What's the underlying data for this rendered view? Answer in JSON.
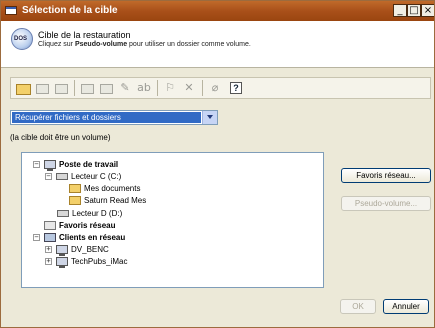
{
  "window": {
    "title": "Sélection de la cible"
  },
  "header": {
    "title": "Cible de la restauration",
    "subtitle_pre": "Cliquez sur ",
    "subtitle_bold": "Pseudo-volume",
    "subtitle_post": " pour utiliser un dossier comme volume."
  },
  "toolbar": {
    "icons": [
      "new-folder-icon",
      "folder-up-icon",
      "folder-icon",
      "properties-icon",
      "new-item-icon",
      "rename-icon",
      "label-icon",
      "flag-icon",
      "delete-icon",
      "edit-icon",
      "help-icon"
    ]
  },
  "dropdown": {
    "selected": "Récupérer fichiers et dossiers"
  },
  "note": "(la cible doit être un volume)",
  "tree": {
    "items": [
      {
        "label": "Poste de travail",
        "bold": true,
        "expander": "−"
      },
      {
        "label": "Lecteur C (C:)",
        "bold": false,
        "expander": "−"
      },
      {
        "label": "Mes documents",
        "bold": false
      },
      {
        "label": "Saturn Read Mes",
        "bold": false
      },
      {
        "label": "Lecteur D (D:)",
        "bold": false
      },
      {
        "label": "Favoris réseau",
        "bold": true
      },
      {
        "label": "Clients en réseau",
        "bold": true,
        "expander": "−"
      },
      {
        "label": "DV_BENC",
        "bold": false,
        "expander": "+"
      },
      {
        "label": "TechPubs_iMac",
        "bold": false,
        "expander": "+"
      }
    ]
  },
  "buttons": {
    "favoris": "Favoris réseau...",
    "pseudo": "Pseudo-volume...",
    "ok": "OK",
    "annuler": "Annuler"
  }
}
